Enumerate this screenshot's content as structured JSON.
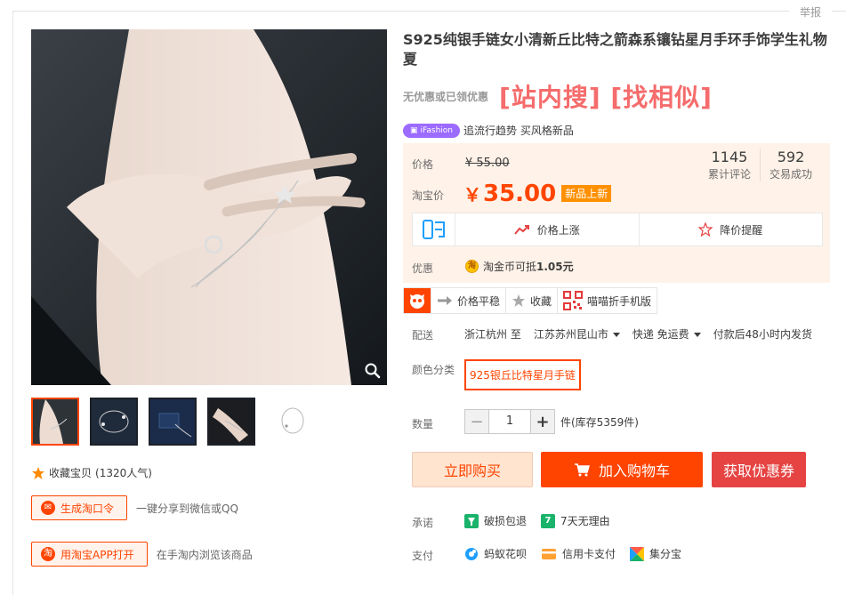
{
  "header": {
    "report_label": "举报"
  },
  "product": {
    "title": "S925纯银手链女小清新丘比特之箭森系镶钻星月手环手饰学生礼物夏",
    "no_promo": "无优惠或已领优惠",
    "search_links": "[站内搜]  [找相似]"
  },
  "ifashion": {
    "badge": "iFashion",
    "text": "追流行趋势 买风格新品"
  },
  "price": {
    "price_label": "价格",
    "original": "¥ 55.00",
    "tb_label": "淘宝价",
    "currency": "￥",
    "amount": "35.00",
    "new_tag": "新品上新",
    "reviews_count": "1145",
    "reviews_label": "累计评论",
    "sales_count": "592",
    "sales_label": "交易成功",
    "price_up": "价格上涨",
    "price_alert": "降价提醒",
    "youhui_label": "优惠",
    "coin_text": "淘金币可抵",
    "coin_amount": "1.05元",
    "coin_glyph": "淘"
  },
  "toolbar": {
    "stable": "价格平稳",
    "favorite": "收藏",
    "mobile": "喵喵折手机版"
  },
  "delivery": {
    "label": "配送",
    "from": "浙江杭州 至",
    "to": "江苏苏州昆山市",
    "method": "快递 免运费",
    "ship_time": "付款后48小时内发货"
  },
  "color": {
    "label": "颜色分类",
    "option": "925银丘比特星月手链"
  },
  "quantity": {
    "label": "数量",
    "value": "1",
    "minus": "−",
    "plus": "+",
    "stock": "件(库存5359件)"
  },
  "actions": {
    "buy": "立即购买",
    "cart": "加入购物车",
    "coupon": "获取优惠券"
  },
  "left": {
    "favorite": "收藏宝贝",
    "popularity": "(1320人气)",
    "gen_code": "生成淘口令",
    "gen_desc": "一键分享到微信或QQ",
    "open_app": "用淘宝APP打开",
    "open_desc": "在手淘内浏览该商品"
  },
  "promise": {
    "label": "承诺",
    "items": [
      "破损包退",
      "7天无理由"
    ]
  },
  "payment": {
    "label": "支付",
    "items": [
      "蚂蚁花呗",
      "信用卡支付",
      "集分宝"
    ]
  },
  "colors": {
    "accent": "#ff4400",
    "promo_red": "#f56c6c",
    "ifashion": "#9c6bff"
  }
}
